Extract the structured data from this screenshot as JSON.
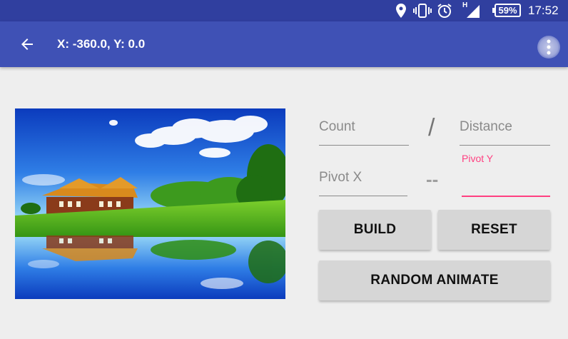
{
  "status_bar": {
    "network_indicator": "H",
    "battery": "59%",
    "time": "17:52",
    "icons": [
      "location-icon",
      "vibrate-icon",
      "alarm-icon",
      "signal-icon",
      "battery-icon"
    ]
  },
  "toolbar": {
    "title": "X: -360.0, Y: 0.0",
    "back_icon": "arrow-left-icon"
  },
  "image": {
    "subject": "house-lake-reflection-landscape"
  },
  "form": {
    "count_placeholder": "Count",
    "slash": "/",
    "distance_placeholder": "Distance",
    "pivot_x_placeholder": "Pivot X",
    "dash": "--",
    "pivot_y_label": "Pivot Y",
    "pivot_y_value": ""
  },
  "buttons": {
    "build": "BUILD",
    "reset": "RESET",
    "random_animate": "RANDOM ANIMATE"
  },
  "colors": {
    "status_bar": "#303f9f",
    "toolbar": "#3f51b5",
    "accent": "#ff4081",
    "background": "#eeeeee",
    "button": "#d6d6d6"
  }
}
